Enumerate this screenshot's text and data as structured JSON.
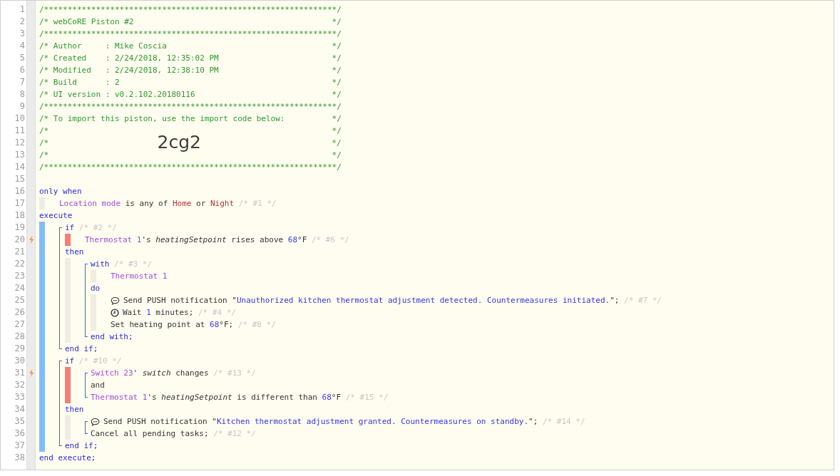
{
  "code": [
    {
      "kind": "header",
      "number": "1",
      "trigger": false,
      "text": "/**************************************************************/"
    },
    {
      "kind": "header",
      "number": "2",
      "trigger": false,
      "text": "/* webCoRE Piston #2",
      "end": "*/"
    },
    {
      "kind": "header",
      "number": "3",
      "trigger": false,
      "text": "/**************************************************************/"
    },
    {
      "kind": "header",
      "number": "4",
      "trigger": false,
      "text": "/* Author     : Mike Coscia",
      "end": "*/"
    },
    {
      "kind": "header",
      "number": "5",
      "trigger": false,
      "text": "/* Created    : 2/24/2018, 12:35:02 PM",
      "end": "*/"
    },
    {
      "kind": "header",
      "number": "6",
      "trigger": false,
      "text": "/* Modified   : 2/24/2018, 12:38:10 PM",
      "end": "*/"
    },
    {
      "kind": "header",
      "number": "7",
      "trigger": false,
      "text": "/* Build      : 2",
      "end": "*/"
    },
    {
      "kind": "header",
      "number": "8",
      "trigger": false,
      "text": "/* UI version : v0.2.102.20180116",
      "end": "*/"
    },
    {
      "kind": "header",
      "number": "9",
      "trigger": false,
      "text": "/**************************************************************/"
    },
    {
      "kind": "header",
      "number": "10",
      "trigger": false,
      "text": "/* To import this piston, use the import code below:",
      "end": "*/"
    },
    {
      "kind": "header",
      "number": "11",
      "trigger": false,
      "text": "/*",
      "end": "*/"
    },
    {
      "kind": "header",
      "number": "12",
      "trigger": false,
      "text": "/*",
      "import_code": "2cg2",
      "end": "*/"
    },
    {
      "kind": "header",
      "number": "13",
      "trigger": false,
      "text": "/*",
      "end": "*/"
    },
    {
      "kind": "header",
      "number": "14",
      "trigger": false,
      "text": "/**************************************************************/"
    },
    {
      "kind": "line",
      "number": "15",
      "trigger": false
    },
    {
      "kind": "line",
      "number": "16",
      "trigger": false,
      "segments": [
        {
          "kind": "keyword",
          "text": "only when"
        }
      ]
    },
    {
      "kind": "block",
      "children": [
        {
          "kind": "line",
          "number": "17",
          "trigger": false,
          "segments": [
            {
              "kind": "device",
              "text": "Location mode"
            },
            {
              "kind": "text",
              "text": " is any of "
            },
            {
              "kind": "value",
              "text": "Home"
            },
            {
              "kind": "text",
              "text": " or "
            },
            {
              "kind": "value",
              "text": "Night"
            },
            {
              "kind": "note",
              "text": " /* #1 */"
            }
          ]
        }
      ]
    },
    {
      "kind": "line",
      "number": "18",
      "trigger": false,
      "segments": [
        {
          "kind": "keyword",
          "text": "execute"
        }
      ]
    },
    {
      "kind": "execute",
      "children": [
        {
          "kind": "bracket",
          "children": [
            {
              "kind": "line",
              "number": "19",
              "trigger": false,
              "segments": [
                {
                  "kind": "keyword",
                  "text": "if"
                },
                {
                  "kind": "note",
                  "text": " /* #2 */"
                }
              ]
            },
            {
              "kind": "condition",
              "children": [
                {
                  "kind": "line",
                  "number": "20",
                  "trigger": true,
                  "segments": [
                    {
                      "kind": "device",
                      "text": "Thermostat 1"
                    },
                    {
                      "kind": "text",
                      "text": "'s "
                    },
                    {
                      "kind": "attribute",
                      "text": "heatingSetpoint"
                    },
                    {
                      "kind": "text",
                      "text": " rises above "
                    },
                    {
                      "kind": "number",
                      "text": "68"
                    },
                    {
                      "kind": "text",
                      "text": "°F"
                    },
                    {
                      "kind": "note",
                      "text": " /* #6 */"
                    }
                  ]
                }
              ]
            },
            {
              "kind": "line",
              "number": "21",
              "trigger": false,
              "segments": [
                {
                  "kind": "keyword",
                  "text": "then"
                }
              ]
            },
            {
              "kind": "block",
              "children": [
                {
                  "kind": "bracket",
                  "children": [
                    {
                      "kind": "line",
                      "number": "22",
                      "trigger": false,
                      "segments": [
                        {
                          "kind": "keyword",
                          "text": "with"
                        },
                        {
                          "kind": "note",
                          "text": " /* #3 */"
                        }
                      ]
                    },
                    {
                      "kind": "block",
                      "children": [
                        {
                          "kind": "line",
                          "number": "23",
                          "trigger": false,
                          "segments": [
                            {
                              "kind": "device",
                              "text": "Thermostat 1"
                            }
                          ]
                        }
                      ]
                    },
                    {
                      "kind": "line",
                      "number": "24",
                      "trigger": false,
                      "segments": [
                        {
                          "kind": "keyword",
                          "text": "do"
                        }
                      ]
                    },
                    {
                      "kind": "block",
                      "children": [
                        {
                          "kind": "notification",
                          "number": "25",
                          "trigger": false,
                          "segments": [
                            {
                              "kind": "text",
                              "text": "Send PUSH notification \""
                            },
                            {
                              "kind": "string",
                              "text": "Unauthorized kitchen thermostat adjustment detected. Countermeasures initiated."
                            },
                            {
                              "kind": "text",
                              "text": "\";"
                            },
                            {
                              "kind": "note",
                              "text": " /* #7 */"
                            }
                          ]
                        },
                        {
                          "kind": "wait",
                          "number": "26",
                          "trigger": false,
                          "segments": [
                            {
                              "kind": "text",
                              "text": "Wait "
                            },
                            {
                              "kind": "number",
                              "text": "1"
                            },
                            {
                              "kind": "text",
                              "text": " minutes;"
                            },
                            {
                              "kind": "note",
                              "text": " /* #4 */"
                            }
                          ]
                        },
                        {
                          "kind": "line",
                          "number": "27",
                          "trigger": false,
                          "segments": [
                            {
                              "kind": "text",
                              "text": "Set heating point at "
                            },
                            {
                              "kind": "number",
                              "text": "68"
                            },
                            {
                              "kind": "text",
                              "text": "°F;"
                            },
                            {
                              "kind": "note",
                              "text": " /* #8 */"
                            }
                          ]
                        }
                      ]
                    },
                    {
                      "kind": "line",
                      "number": "28",
                      "trigger": false,
                      "segments": [
                        {
                          "kind": "keyword",
                          "text": "end with;"
                        }
                      ]
                    }
                  ]
                }
              ]
            },
            {
              "kind": "line",
              "number": "29",
              "trigger": false,
              "segments": [
                {
                  "kind": "keyword",
                  "text": "end if;"
                }
              ]
            }
          ]
        },
        {
          "kind": "bracket",
          "children": [
            {
              "kind": "line",
              "number": "30",
              "trigger": false,
              "segments": [
                {
                  "kind": "keyword",
                  "text": "if"
                },
                {
                  "kind": "note",
                  "text": " /* #10 */"
                }
              ]
            },
            {
              "kind": "condition",
              "children": [
                {
                  "kind": "bracket",
                  "children": [
                    {
                      "kind": "line",
                      "number": "31",
                      "trigger": true,
                      "segments": [
                        {
                          "kind": "device",
                          "text": "Switch 23"
                        },
                        {
                          "kind": "text",
                          "text": "' "
                        },
                        {
                          "kind": "attribute",
                          "text": "switch"
                        },
                        {
                          "kind": "text",
                          "text": " changes"
                        },
                        {
                          "kind": "note",
                          "text": " /* #13 */"
                        }
                      ]
                    },
                    {
                      "kind": "line",
                      "number": "32",
                      "trigger": false,
                      "segments": [
                        {
                          "kind": "text",
                          "text": "and"
                        }
                      ]
                    },
                    {
                      "kind": "line",
                      "number": "33",
                      "trigger": false,
                      "segments": [
                        {
                          "kind": "device",
                          "text": "Thermostat 1"
                        },
                        {
                          "kind": "text",
                          "text": "'s "
                        },
                        {
                          "kind": "attribute",
                          "text": "heatingSetpoint"
                        },
                        {
                          "kind": "text",
                          "text": " is different than "
                        },
                        {
                          "kind": "number",
                          "text": "68"
                        },
                        {
                          "kind": "text",
                          "text": "°F"
                        },
                        {
                          "kind": "note",
                          "text": " /* #15 */"
                        }
                      ]
                    }
                  ]
                }
              ]
            },
            {
              "kind": "line",
              "number": "34",
              "trigger": false,
              "segments": [
                {
                  "kind": "keyword",
                  "text": "then"
                }
              ]
            },
            {
              "kind": "block",
              "children": [
                {
                  "kind": "bracket",
                  "children": [
                    {
                      "kind": "notification",
                      "number": "35",
                      "trigger": false,
                      "segments": [
                        {
                          "kind": "text",
                          "text": "Send PUSH notification \""
                        },
                        {
                          "kind": "string",
                          "text": "Kitchen thermostat adjustment granted. Countermeasures on standby."
                        },
                        {
                          "kind": "text",
                          "text": "\";"
                        },
                        {
                          "kind": "note",
                          "text": " /* #14 */"
                        }
                      ]
                    },
                    {
                      "kind": "line",
                      "number": "36",
                      "trigger": false,
                      "segments": [
                        {
                          "kind": "text",
                          "text": "Cancel all pending tasks;"
                        },
                        {
                          "kind": "note",
                          "text": " /* #12 */"
                        }
                      ]
                    }
                  ]
                }
              ]
            },
            {
              "kind": "line",
              "number": "37",
              "trigger": false,
              "segments": [
                {
                  "kind": "keyword",
                  "text": "end if;"
                }
              ]
            }
          ]
        }
      ]
    },
    {
      "kind": "line",
      "number": "38",
      "trigger": false,
      "segments": [
        {
          "kind": "keyword",
          "text": "end execute;"
        }
      ]
    }
  ]
}
